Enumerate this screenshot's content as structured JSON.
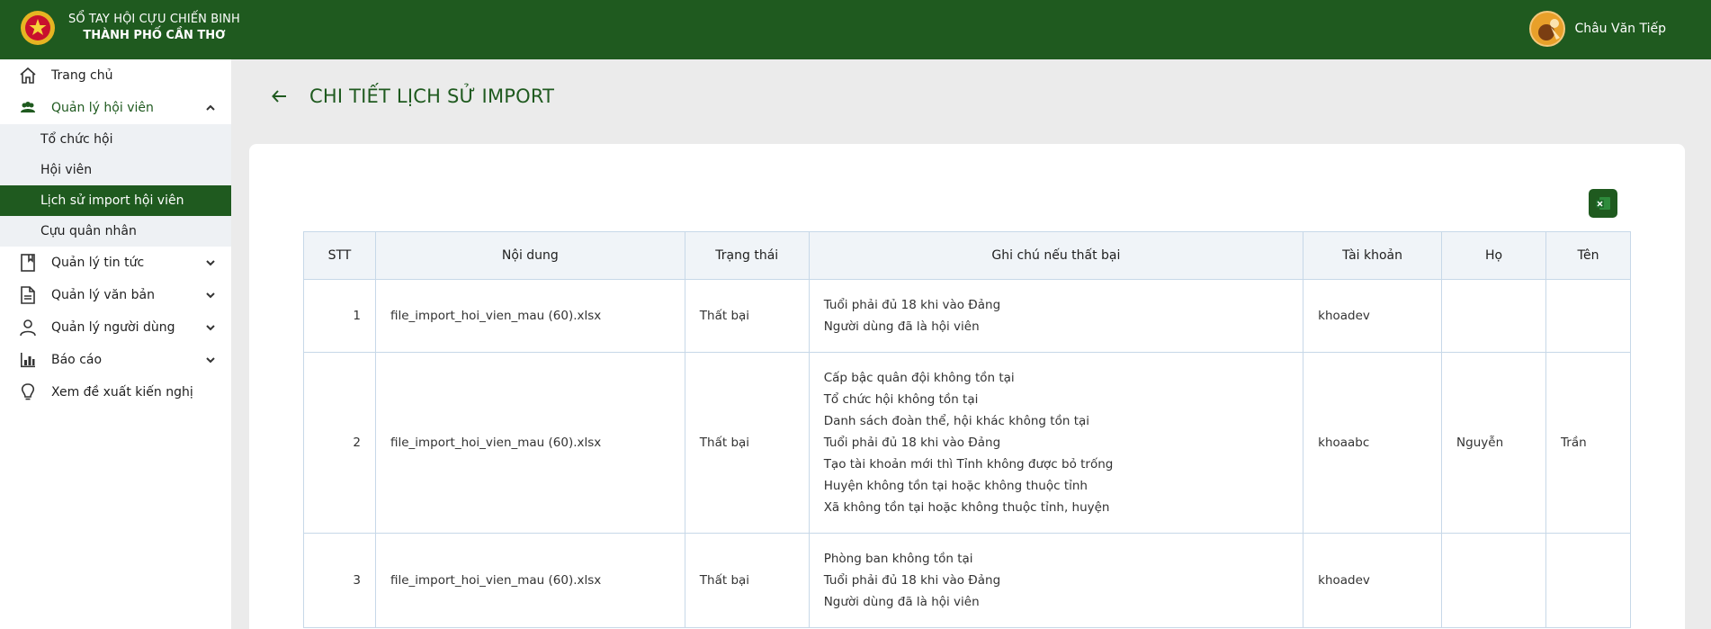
{
  "header": {
    "brand_line1": "SỔ TAY HỘI CỰU CHIẾN BINH",
    "brand_line2": "THÀNH PHỐ CẦN THƠ",
    "user_name": "Châu Văn Tiếp"
  },
  "sidebar": {
    "home": "Trang chủ",
    "members_group": "Quản lý hội viên",
    "members_sub": [
      "Tổ chức hội",
      "Hội viên",
      "Lịch sử import hội viên",
      "Cựu quân nhân"
    ],
    "news": "Quản lý tin tức",
    "documents": "Quản lý văn bản",
    "users": "Quản lý người dùng",
    "reports": "Báo cáo",
    "proposals": "Xem đề xuất kiến nghị"
  },
  "page": {
    "title": "CHI TIẾT LỊCH SỬ IMPORT"
  },
  "table": {
    "headers": [
      "STT",
      "Nội dung",
      "Trạng thái",
      "Ghi chú nếu thất bại",
      "Tài khoản",
      "Họ",
      "Tên"
    ],
    "rows": [
      {
        "stt": "1",
        "content": "file_import_hoi_vien_mau (60).xlsx",
        "status": "Thất bại",
        "notes": [
          "Tuổi phải đủ 18 khi vào Đảng",
          "Người dùng đã là hội viên"
        ],
        "account": "khoadev",
        "last": "",
        "first": ""
      },
      {
        "stt": "2",
        "content": "file_import_hoi_vien_mau (60).xlsx",
        "status": "Thất bại",
        "notes": [
          "Cấp bậc quân đội không tồn tại",
          "Tổ chức hội không tồn tại",
          "Danh sách đoàn thể, hội khác không tồn tại",
          "Tuổi phải đủ 18 khi vào Đảng",
          "Tạo tài khoản mới thì Tỉnh không được bỏ trống",
          "Huyện không tồn tại hoặc không thuộc tỉnh",
          "Xã không tồn tại hoặc không thuộc tỉnh, huyện"
        ],
        "account": "khoaabc",
        "last": "Nguyễn",
        "first": "Trần"
      },
      {
        "stt": "3",
        "content": "file_import_hoi_vien_mau (60).xlsx",
        "status": "Thất bại",
        "notes": [
          "Phòng ban không tồn tại",
          "Tuổi phải đủ 18 khi vào Đảng",
          "Người dùng đã là hội viên"
        ],
        "account": "khoadev",
        "last": "",
        "first": ""
      }
    ]
  },
  "colors": {
    "primary": "#1f5a1f",
    "background": "#ebebeb",
    "border": "#c7d8e8"
  }
}
